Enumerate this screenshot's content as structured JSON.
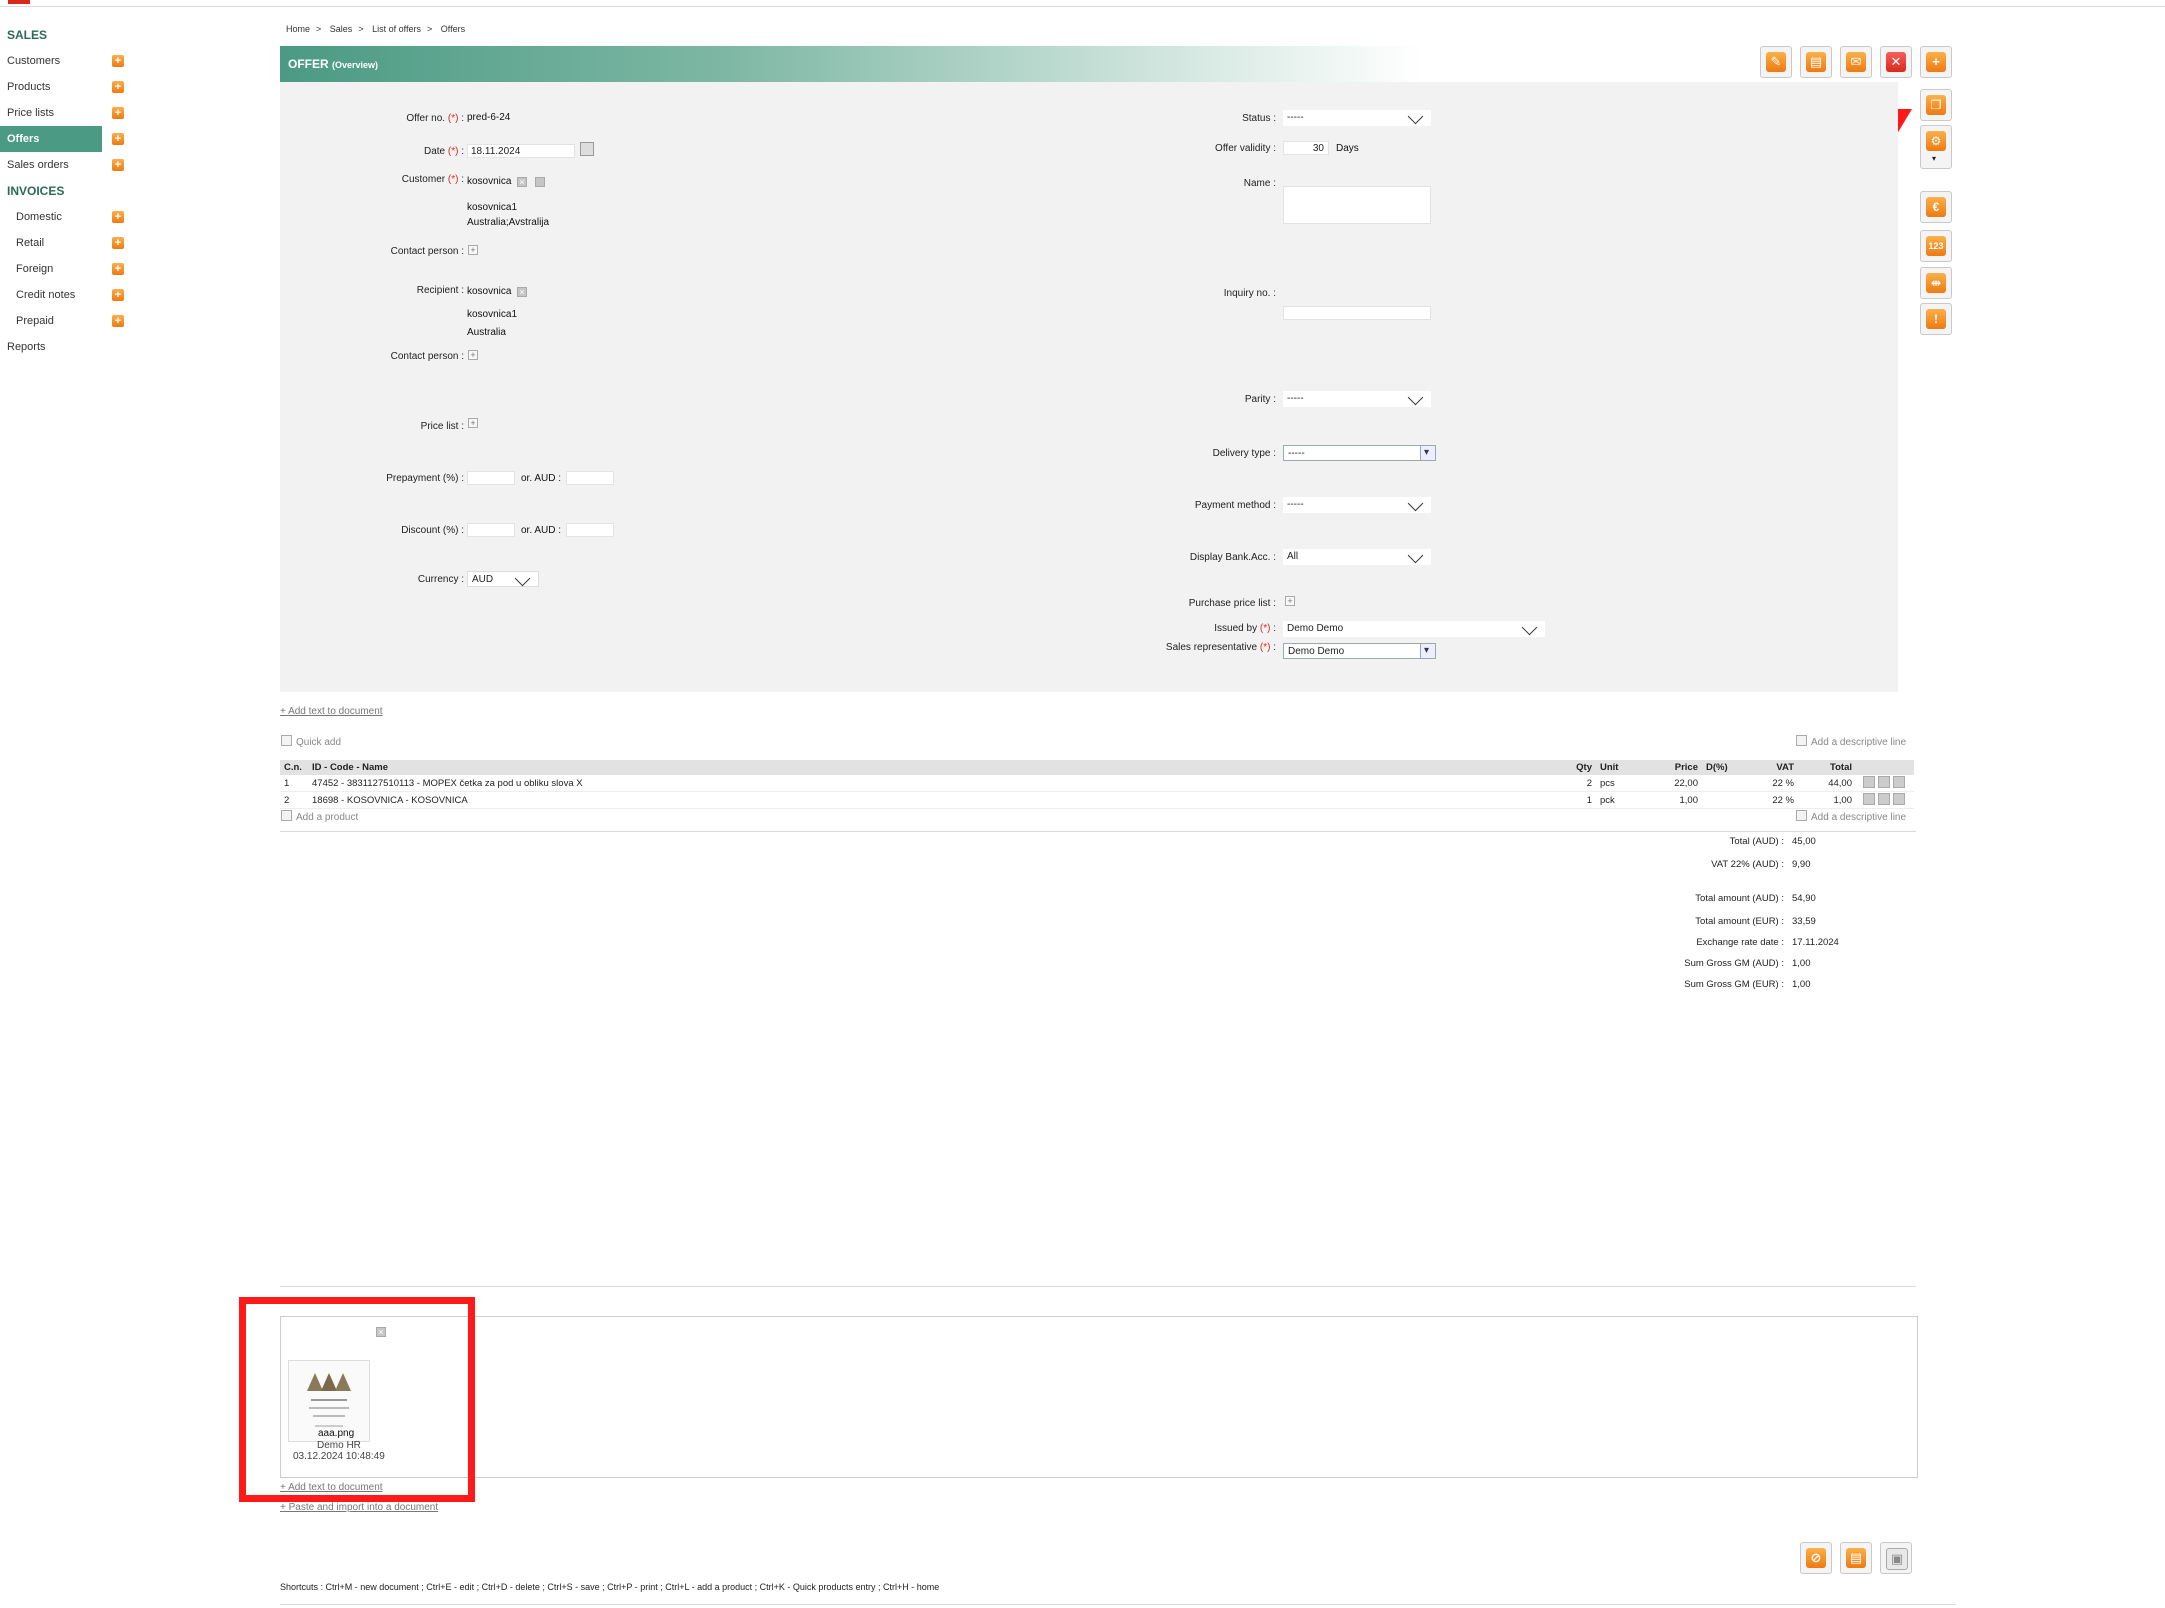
{
  "sidebar": {
    "sales_heading": "SALES",
    "sales_items": [
      "Customers",
      "Products",
      "Price lists",
      "Offers",
      "Sales orders"
    ],
    "invoices_heading": "INVOICES",
    "invoice_items": [
      "Domestic",
      "Retail",
      "Foreign",
      "Credit notes",
      "Prepaid"
    ],
    "reports": "Reports"
  },
  "breadcrumb": [
    "Home",
    "Sales",
    "List of offers",
    "Offers"
  ],
  "title": {
    "main": "OFFER",
    "sub": "(Overview)"
  },
  "form": {
    "offer_no_label": "Offer no.",
    "offer_no": "pred-6-24",
    "date_label": "Date",
    "date": "18.11.2024",
    "customer_label": "Customer",
    "customer": "kosovnica",
    "customer_line2": "kosovnica1",
    "customer_line3": "Australia;Avstralija",
    "contact_label": "Contact person :",
    "recipient_label": "Recipient :",
    "recipient": "kosovnica",
    "recipient_line2": "kosovnica1",
    "recipient_line3": "Australia",
    "contact2_label": "Contact person :",
    "price_list_label": "Price list :",
    "prepayment_label": "Prepayment (%) :",
    "or_aud": "or. AUD :",
    "discount_label": "Discount (%) :",
    "or_aud2": "or. AUD :",
    "currency_label": "Currency :",
    "currency": "AUD",
    "status_label": "Status :",
    "status": "-----",
    "validity_label": "Offer validity :",
    "validity": "30",
    "validity_unit": "Days",
    "name_label": "Name :",
    "inquiry_label": "Inquiry no. :",
    "parity_label": "Parity :",
    "parity": "-----",
    "delivery_label": "Delivery type :",
    "delivery": "-----",
    "payment_label": "Payment method :",
    "payment": "-----",
    "bank_label": "Display Bank.Acc. :",
    "bank": "All",
    "purchase_label": "Purchase price list :",
    "issued_label": "Issued by",
    "issued": "Demo Demo",
    "salesrep_label": "Sales representative",
    "salesrep": "Demo Demo",
    "req_mark": "(*)"
  },
  "links": {
    "add_text": "+ Add text to document",
    "quick_add": "Quick add",
    "add_desc_line": "Add a descriptive line",
    "add_product": "Add a product",
    "add_desc_line2": "Add a descriptive line",
    "add_text2": "+ Add text to document",
    "paste_import": "+ Paste and import into a document"
  },
  "table": {
    "headers": [
      "C.n.",
      "ID - Code - Name",
      "Qty",
      "Unit",
      "Price",
      "D(%)",
      "VAT",
      "Total"
    ],
    "rows": [
      [
        "1",
        "47452 - 3831127510113 - MOPEX četka za pod u obliku slova X",
        "2",
        "pcs",
        "22,00",
        "",
        "22 %",
        "44,00"
      ],
      [
        "2",
        "18698 - KOSOVNICA - KOSOVNICA",
        "1",
        "pck",
        "1,00",
        "",
        "22 %",
        "1,00"
      ]
    ]
  },
  "totals": [
    [
      "Total (AUD) :",
      "45,00"
    ],
    [
      "VAT 22% (AUD) :",
      "9,90"
    ],
    [
      "Total amount (AUD) :",
      "54,90"
    ],
    [
      "Total amount (EUR) :",
      "33,59"
    ],
    [
      "Exchange rate date :",
      "17.11.2024"
    ],
    [
      "Sum Gross GM (AUD) :",
      "1,00"
    ],
    [
      "Sum Gross GM (EUR) :",
      "1,00"
    ]
  ],
  "attachment": {
    "filename": "aaa.png",
    "author": "Demo HR",
    "datetime": "03.12.2024 10:48:49"
  },
  "shortcuts": "Shortcuts : Ctrl+M - new document ;  Ctrl+E - edit ;  Ctrl+D - delete ;  Ctrl+S - save ;  Ctrl+P - print ;  Ctrl+L - add a product ;  Ctrl+K - Quick products entry ;  Ctrl+H - home",
  "icons": {
    "toolbar": [
      "edit-icon",
      "print-icon",
      "email-icon",
      "delete-icon",
      "add-icon"
    ],
    "side": [
      "copy-icon",
      "settings-icon",
      "euro-icon",
      "calculator-icon",
      "split-icon",
      "warning-icon"
    ],
    "footer": [
      "cancel-icon",
      "print-icon",
      "save-icon"
    ]
  },
  "colors": {
    "accent": "#4b9a83",
    "orange": "#ee7a12",
    "red": "#d9281c",
    "highlight": "#ff1a1a"
  }
}
